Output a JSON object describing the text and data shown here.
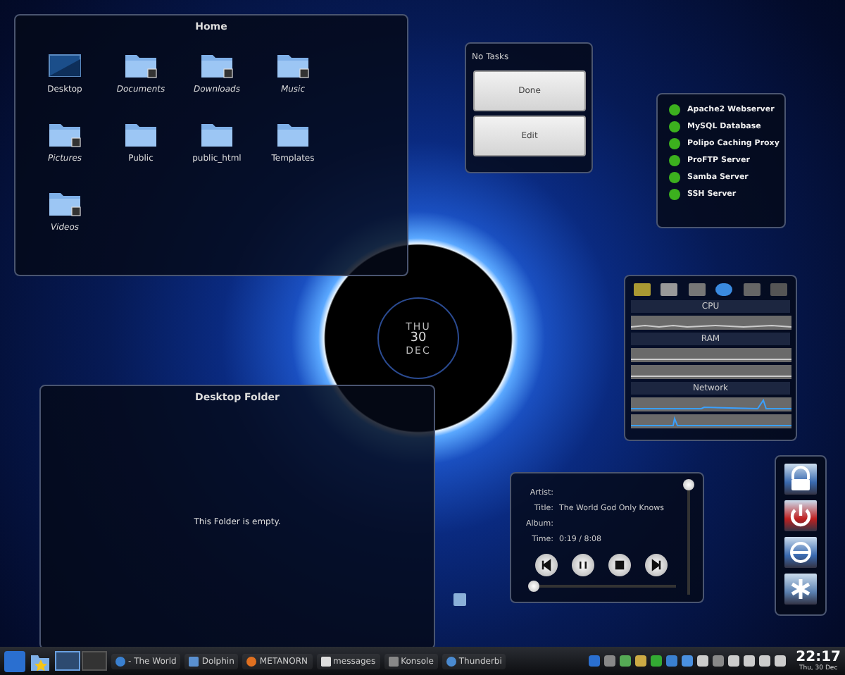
{
  "home": {
    "title": "Home",
    "items": [
      {
        "label": "Desktop",
        "kind": "desktop"
      },
      {
        "label": "Documents",
        "kind": "link"
      },
      {
        "label": "Downloads",
        "kind": "link"
      },
      {
        "label": "Music",
        "kind": "link"
      },
      {
        "label": "Pictures",
        "kind": "link"
      },
      {
        "label": "Public",
        "kind": "folder"
      },
      {
        "label": "public_html",
        "kind": "folder"
      },
      {
        "label": "Templates",
        "kind": "folder"
      },
      {
        "label": "Videos",
        "kind": "link"
      }
    ]
  },
  "tasks": {
    "status": "No Tasks",
    "buttons": [
      "Done",
      "Edit"
    ]
  },
  "services": [
    {
      "name": "Apache2 Webserver",
      "running": true
    },
    {
      "name": "MySQL Database",
      "running": true
    },
    {
      "name": "Polipo Caching Proxy",
      "running": true
    },
    {
      "name": "ProFTP Server",
      "running": true
    },
    {
      "name": "Samba Server",
      "running": true
    },
    {
      "name": "SSH Server",
      "running": true
    }
  ],
  "system_monitor": {
    "sections": [
      {
        "title": "CPU",
        "kind": "cpu"
      },
      {
        "title": "RAM",
        "kind": "ram"
      },
      {
        "title": "Network",
        "kind": "network"
      }
    ]
  },
  "clock": {
    "weekday": "THU",
    "day": "30",
    "month": "DEC"
  },
  "desktop_folder": {
    "title": "Desktop Folder",
    "message": "This Folder is empty."
  },
  "player": {
    "fields": [
      {
        "label": "Artist:"
      },
      {
        "label": "Title:",
        "value": "The World God Only Knows"
      },
      {
        "label": "Album:"
      },
      {
        "label": "Time:",
        "value": "0:19 / 8:08"
      }
    ],
    "volume": {
      "level": 1.0
    },
    "position": {
      "level": 0.04
    }
  },
  "taskbar": {
    "pager": [
      {
        "selected": true
      },
      {
        "selected": false
      }
    ],
    "tasks": [
      {
        "label": "- The World",
        "kind": "globe"
      },
      {
        "label": "Dolphin",
        "kind": "files"
      },
      {
        "label": "METANORN",
        "kind": "fox"
      },
      {
        "label": "messages",
        "kind": "doc"
      },
      {
        "label": "Konsole",
        "kind": "terminal"
      },
      {
        "label": "Thunderbi",
        "kind": "mail"
      }
    ],
    "clock": {
      "time": "22:17",
      "date": "Thu, 30 Dec"
    }
  }
}
